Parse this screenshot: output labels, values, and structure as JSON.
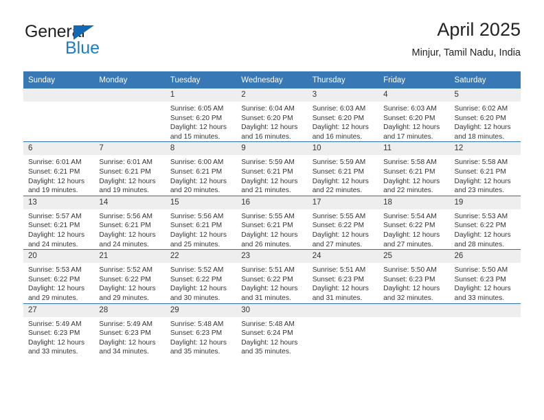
{
  "brand": {
    "name_part1": "General",
    "name_part2": "Blue",
    "flag_icon": "triangle-flag-icon",
    "accent_color": "#1368b3"
  },
  "header": {
    "title": "April 2025",
    "subtitle": "Minjur, Tamil Nadu, India"
  },
  "theme": {
    "header_bg": "#3878b4",
    "row_divider": "#2f6fae",
    "daynum_bg": "#eeeeee",
    "text": "#333333"
  },
  "calendar": {
    "weekday_headers": [
      "Sunday",
      "Monday",
      "Tuesday",
      "Wednesday",
      "Thursday",
      "Friday",
      "Saturday"
    ],
    "weeks": [
      [
        {
          "day": "",
          "blank": true
        },
        {
          "day": "",
          "blank": true
        },
        {
          "day": "1",
          "sunrise": "Sunrise: 6:05 AM",
          "sunset": "Sunset: 6:20 PM",
          "daylight": "Daylight: 12 hours and 15 minutes."
        },
        {
          "day": "2",
          "sunrise": "Sunrise: 6:04 AM",
          "sunset": "Sunset: 6:20 PM",
          "daylight": "Daylight: 12 hours and 16 minutes."
        },
        {
          "day": "3",
          "sunrise": "Sunrise: 6:03 AM",
          "sunset": "Sunset: 6:20 PM",
          "daylight": "Daylight: 12 hours and 16 minutes."
        },
        {
          "day": "4",
          "sunrise": "Sunrise: 6:03 AM",
          "sunset": "Sunset: 6:20 PM",
          "daylight": "Daylight: 12 hours and 17 minutes."
        },
        {
          "day": "5",
          "sunrise": "Sunrise: 6:02 AM",
          "sunset": "Sunset: 6:20 PM",
          "daylight": "Daylight: 12 hours and 18 minutes."
        }
      ],
      [
        {
          "day": "6",
          "sunrise": "Sunrise: 6:01 AM",
          "sunset": "Sunset: 6:21 PM",
          "daylight": "Daylight: 12 hours and 19 minutes."
        },
        {
          "day": "7",
          "sunrise": "Sunrise: 6:01 AM",
          "sunset": "Sunset: 6:21 PM",
          "daylight": "Daylight: 12 hours and 19 minutes."
        },
        {
          "day": "8",
          "sunrise": "Sunrise: 6:00 AM",
          "sunset": "Sunset: 6:21 PM",
          "daylight": "Daylight: 12 hours and 20 minutes."
        },
        {
          "day": "9",
          "sunrise": "Sunrise: 5:59 AM",
          "sunset": "Sunset: 6:21 PM",
          "daylight": "Daylight: 12 hours and 21 minutes."
        },
        {
          "day": "10",
          "sunrise": "Sunrise: 5:59 AM",
          "sunset": "Sunset: 6:21 PM",
          "daylight": "Daylight: 12 hours and 22 minutes."
        },
        {
          "day": "11",
          "sunrise": "Sunrise: 5:58 AM",
          "sunset": "Sunset: 6:21 PM",
          "daylight": "Daylight: 12 hours and 22 minutes."
        },
        {
          "day": "12",
          "sunrise": "Sunrise: 5:58 AM",
          "sunset": "Sunset: 6:21 PM",
          "daylight": "Daylight: 12 hours and 23 minutes."
        }
      ],
      [
        {
          "day": "13",
          "sunrise": "Sunrise: 5:57 AM",
          "sunset": "Sunset: 6:21 PM",
          "daylight": "Daylight: 12 hours and 24 minutes."
        },
        {
          "day": "14",
          "sunrise": "Sunrise: 5:56 AM",
          "sunset": "Sunset: 6:21 PM",
          "daylight": "Daylight: 12 hours and 24 minutes."
        },
        {
          "day": "15",
          "sunrise": "Sunrise: 5:56 AM",
          "sunset": "Sunset: 6:21 PM",
          "daylight": "Daylight: 12 hours and 25 minutes."
        },
        {
          "day": "16",
          "sunrise": "Sunrise: 5:55 AM",
          "sunset": "Sunset: 6:21 PM",
          "daylight": "Daylight: 12 hours and 26 minutes."
        },
        {
          "day": "17",
          "sunrise": "Sunrise: 5:55 AM",
          "sunset": "Sunset: 6:22 PM",
          "daylight": "Daylight: 12 hours and 27 minutes."
        },
        {
          "day": "18",
          "sunrise": "Sunrise: 5:54 AM",
          "sunset": "Sunset: 6:22 PM",
          "daylight": "Daylight: 12 hours and 27 minutes."
        },
        {
          "day": "19",
          "sunrise": "Sunrise: 5:53 AM",
          "sunset": "Sunset: 6:22 PM",
          "daylight": "Daylight: 12 hours and 28 minutes."
        }
      ],
      [
        {
          "day": "20",
          "sunrise": "Sunrise: 5:53 AM",
          "sunset": "Sunset: 6:22 PM",
          "daylight": "Daylight: 12 hours and 29 minutes."
        },
        {
          "day": "21",
          "sunrise": "Sunrise: 5:52 AM",
          "sunset": "Sunset: 6:22 PM",
          "daylight": "Daylight: 12 hours and 29 minutes."
        },
        {
          "day": "22",
          "sunrise": "Sunrise: 5:52 AM",
          "sunset": "Sunset: 6:22 PM",
          "daylight": "Daylight: 12 hours and 30 minutes."
        },
        {
          "day": "23",
          "sunrise": "Sunrise: 5:51 AM",
          "sunset": "Sunset: 6:22 PM",
          "daylight": "Daylight: 12 hours and 31 minutes."
        },
        {
          "day": "24",
          "sunrise": "Sunrise: 5:51 AM",
          "sunset": "Sunset: 6:23 PM",
          "daylight": "Daylight: 12 hours and 31 minutes."
        },
        {
          "day": "25",
          "sunrise": "Sunrise: 5:50 AM",
          "sunset": "Sunset: 6:23 PM",
          "daylight": "Daylight: 12 hours and 32 minutes."
        },
        {
          "day": "26",
          "sunrise": "Sunrise: 5:50 AM",
          "sunset": "Sunset: 6:23 PM",
          "daylight": "Daylight: 12 hours and 33 minutes."
        }
      ],
      [
        {
          "day": "27",
          "sunrise": "Sunrise: 5:49 AM",
          "sunset": "Sunset: 6:23 PM",
          "daylight": "Daylight: 12 hours and 33 minutes."
        },
        {
          "day": "28",
          "sunrise": "Sunrise: 5:49 AM",
          "sunset": "Sunset: 6:23 PM",
          "daylight": "Daylight: 12 hours and 34 minutes."
        },
        {
          "day": "29",
          "sunrise": "Sunrise: 5:48 AM",
          "sunset": "Sunset: 6:23 PM",
          "daylight": "Daylight: 12 hours and 35 minutes."
        },
        {
          "day": "30",
          "sunrise": "Sunrise: 5:48 AM",
          "sunset": "Sunset: 6:24 PM",
          "daylight": "Daylight: 12 hours and 35 minutes."
        },
        {
          "day": "",
          "blank": true
        },
        {
          "day": "",
          "blank": true
        },
        {
          "day": "",
          "blank": true
        }
      ]
    ]
  }
}
